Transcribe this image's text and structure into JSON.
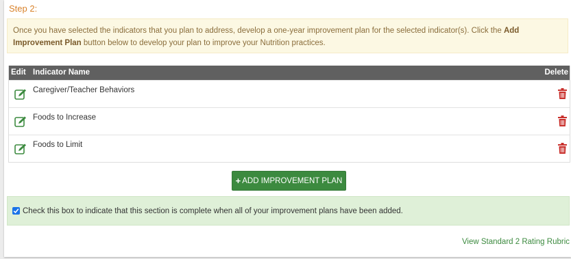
{
  "step": {
    "title": "Step 2:"
  },
  "instructions": {
    "before": "Once you have selected the indicators that you plan to address, develop a one-year improvement plan for the selected indicator(s). Click the ",
    "bold": "Add Improvement Plan",
    "after": " button below to develop your plan to improve your Nutrition practices."
  },
  "table": {
    "headers": {
      "edit": "Edit",
      "name": "Indicator Name",
      "delete": "Delete"
    },
    "rows": [
      {
        "name": "Caregiver/Teacher Behaviors"
      },
      {
        "name": "Foods to Increase"
      },
      {
        "name": "Foods to Limit"
      }
    ]
  },
  "actions": {
    "add_plus": "+",
    "add_label": "ADD IMPROVEMENT PLAN"
  },
  "completion": {
    "checked": true,
    "label": "Check this box to indicate that this section is complete when all of your improvement plans have been added."
  },
  "links": {
    "rubric": "View Standard 2 Rating Rubric"
  },
  "icons": {
    "edit": "edit-pencil-icon",
    "delete": "trash-icon",
    "check": "checkmark-icon"
  },
  "colors": {
    "step_title": "#d9822b",
    "header_bg": "#606060",
    "primary_green": "#3c8a3f",
    "delete_red": "#c9302c",
    "warning_bg": "#fcf8e3",
    "success_bg": "#dff0d8",
    "checkbox": "#1b73e8"
  }
}
